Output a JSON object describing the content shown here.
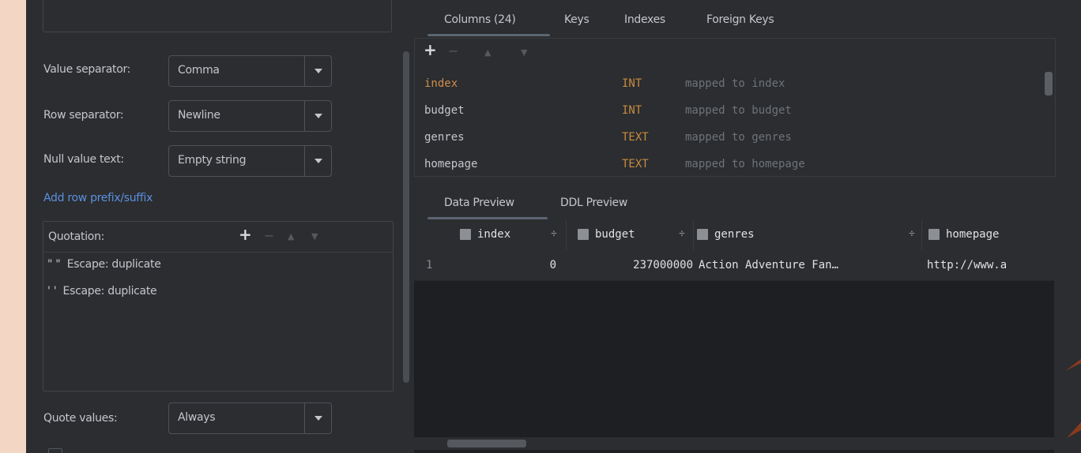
{
  "form": {
    "value_separator": {
      "label": "Value separator:",
      "value": "Comma"
    },
    "row_separator": {
      "label": "Row separator:",
      "value": "Newline"
    },
    "null_value_text": {
      "label": "Null value text:",
      "value": "Empty string"
    },
    "add_row_link": "Add row prefix/suffix",
    "quotation": {
      "label": "Quotation:",
      "items": [
        "\" \"  Escape: duplicate",
        "' '  Escape: duplicate"
      ]
    },
    "quote_values": {
      "label": "Quote values:",
      "value": "Always"
    }
  },
  "top_tabs": [
    "Columns (24)",
    "Keys",
    "Indexes",
    "Foreign Keys"
  ],
  "columns": [
    {
      "name": "index",
      "type": "INT",
      "mapping": "mapped to index"
    },
    {
      "name": "budget",
      "type": "INT",
      "mapping": "mapped to budget"
    },
    {
      "name": "genres",
      "type": "TEXT",
      "mapping": "mapped to genres"
    },
    {
      "name": "homepage",
      "type": "TEXT",
      "mapping": "mapped to homepage"
    }
  ],
  "preview_tabs": [
    "Data Preview",
    "DDL Preview"
  ],
  "grid": {
    "headers": [
      "index",
      "budget",
      "genres",
      "homepage"
    ],
    "rows": [
      {
        "num": "1",
        "cells": [
          "0",
          "237000000",
          "Action Adventure Fan…",
          "http://www.a"
        ]
      }
    ]
  },
  "icons": {
    "add": "+",
    "remove": "−",
    "move_up": "▲",
    "move_down": "▼",
    "sort": "÷"
  },
  "colors": {
    "accent_link": "#5c90e0",
    "type_color": "#c98a3f",
    "background": "#2b2d30"
  }
}
